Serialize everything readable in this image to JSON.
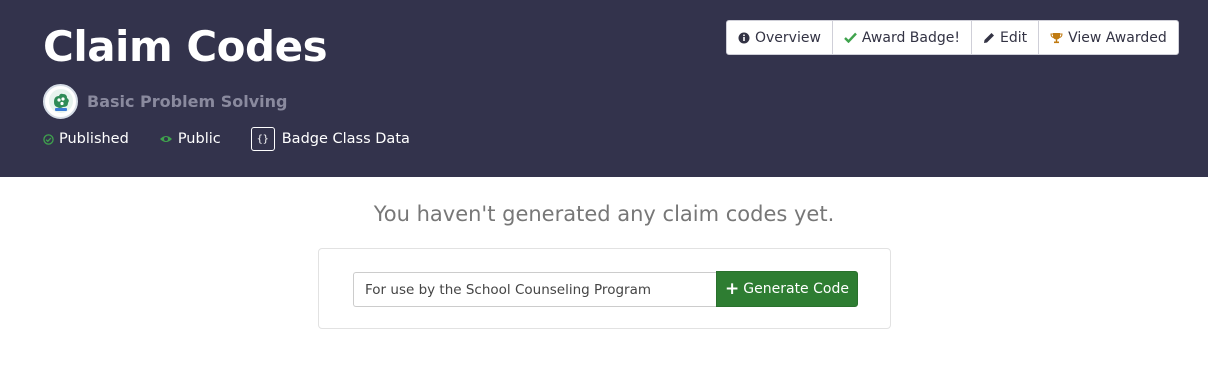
{
  "header": {
    "title": "Claim Codes",
    "badge": {
      "name": "Basic Problem Solving",
      "icon": "badge-image-icon"
    },
    "meta": {
      "published": "Published",
      "public": "Public",
      "badge_class_data": "Badge Class Data",
      "badge_class_data_icon_text": "{}"
    },
    "actions": {
      "overview": "Overview",
      "award_badge": "Award Badge!",
      "edit": "Edit",
      "view_awarded": "View Awarded"
    }
  },
  "main": {
    "empty_message": "You haven't generated any claim codes yet.",
    "code_input": {
      "value": "For use by the School Counseling Program"
    },
    "generate_button": {
      "icon_text": "+",
      "label": "Generate Code"
    }
  },
  "colors": {
    "header_bg": "#33334c",
    "accent_green": "#2e7d32",
    "status_green": "#3fa34d",
    "trophy_orange": "#c07a10"
  }
}
